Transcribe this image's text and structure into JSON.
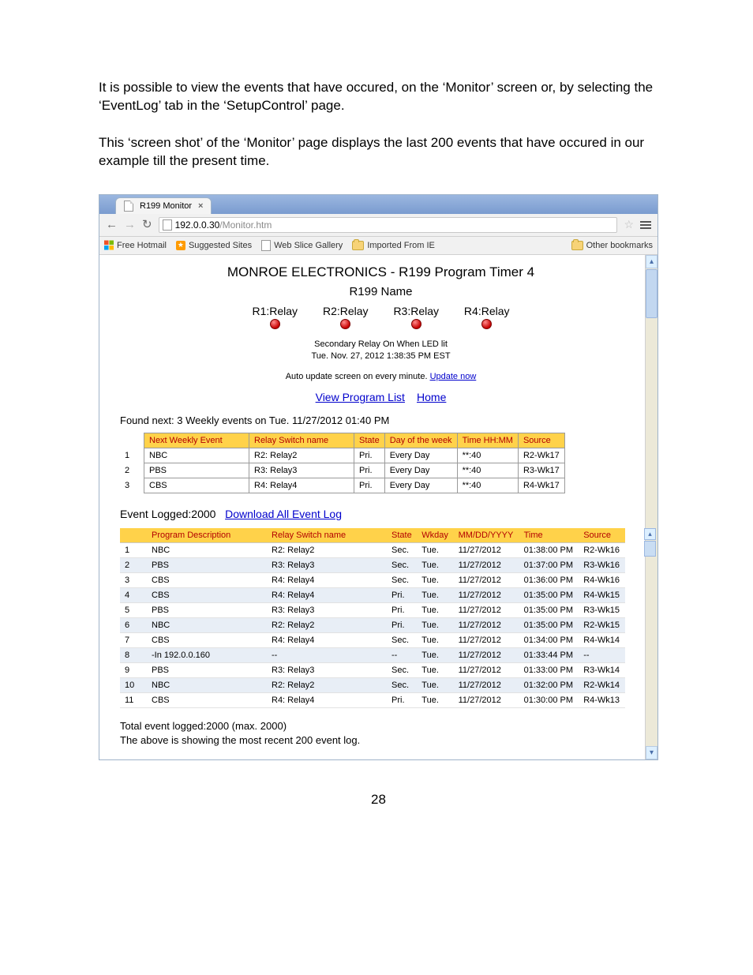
{
  "doc": {
    "para1": "It is possible to view the events that have occured, on the ‘Monitor’ screen or, by selecting the ‘EventLog’ tab in the ‘SetupControl’ page.",
    "para2": "This ‘screen shot’ of the ‘Monitor’ page displays the last 200 events that have occured in our example till the present time.",
    "page_number": "28"
  },
  "browser": {
    "tab_title": "R199 Monitor",
    "url_host": "192.0.0.30",
    "url_path": "/Monitor.htm",
    "bookmarks": {
      "free_hotmail": "Free Hotmail",
      "suggested_sites": "Suggested Sites",
      "web_slice_gallery": "Web Slice Gallery",
      "imported_from_ie": "Imported From IE",
      "other_bookmarks": "Other bookmarks"
    }
  },
  "monitor": {
    "title": "MONROE ELECTRONICS - R199 Program Timer 4",
    "name": "R199 Name",
    "relays": [
      "R1:Relay",
      "R2:Relay",
      "R3:Relay",
      "R4:Relay"
    ],
    "secondary_line1": "Secondary Relay On When LED lit",
    "secondary_line2": "Tue. Nov. 27, 2012 1:38:35 PM EST",
    "auto_update_text": "Auto update screen on every minute. ",
    "update_now": "Update now",
    "view_program_list": "View Program List",
    "home": "Home",
    "found_next": "Found next: 3 Weekly events on Tue. 11/27/2012 01:40 PM",
    "weekly_headers": [
      "Next Weekly Event",
      "Relay Switch name",
      "State",
      "Day of the week",
      "Time HH:MM",
      "Source"
    ],
    "weekly_rows": [
      {
        "n": "1",
        "event": "NBC",
        "relay": "R2: Relay2",
        "state": "Pri.",
        "day": "Every Day",
        "time": "**:40",
        "source": "R2-Wk17"
      },
      {
        "n": "2",
        "event": "PBS",
        "relay": "R3: Relay3",
        "state": "Pri.",
        "day": "Every Day",
        "time": "**:40",
        "source": "R3-Wk17"
      },
      {
        "n": "3",
        "event": "CBS",
        "relay": "R4: Relay4",
        "state": "Pri.",
        "day": "Every Day",
        "time": "**:40",
        "source": "R4-Wk17"
      }
    ],
    "event_logged_label": "Event Logged:2000",
    "download_link": "Download All Event Log",
    "log_headers": [
      "",
      "Program Description",
      "Relay Switch name",
      "State",
      "Wkday",
      "MM/DD/YYYY",
      "Time",
      "Source"
    ],
    "log_rows": [
      {
        "n": "1",
        "desc": "NBC",
        "relay": "R2: Relay2",
        "state": "Sec.",
        "wk": "Tue.",
        "date": "11/27/2012",
        "time": "01:38:00 PM",
        "src": "R2-Wk16"
      },
      {
        "n": "2",
        "desc": "PBS",
        "relay": "R3: Relay3",
        "state": "Sec.",
        "wk": "Tue.",
        "date": "11/27/2012",
        "time": "01:37:00 PM",
        "src": "R3-Wk16"
      },
      {
        "n": "3",
        "desc": "CBS",
        "relay": "R4: Relay4",
        "state": "Sec.",
        "wk": "Tue.",
        "date": "11/27/2012",
        "time": "01:36:00 PM",
        "src": "R4-Wk16"
      },
      {
        "n": "4",
        "desc": "CBS",
        "relay": "R4: Relay4",
        "state": "Pri.",
        "wk": "Tue.",
        "date": "11/27/2012",
        "time": "01:35:00 PM",
        "src": "R4-Wk15"
      },
      {
        "n": "5",
        "desc": "PBS",
        "relay": "R3: Relay3",
        "state": "Pri.",
        "wk": "Tue.",
        "date": "11/27/2012",
        "time": "01:35:00 PM",
        "src": "R3-Wk15"
      },
      {
        "n": "6",
        "desc": "NBC",
        "relay": "R2: Relay2",
        "state": "Pri.",
        "wk": "Tue.",
        "date": "11/27/2012",
        "time": "01:35:00 PM",
        "src": "R2-Wk15"
      },
      {
        "n": "7",
        "desc": "CBS",
        "relay": "R4: Relay4",
        "state": "Sec.",
        "wk": "Tue.",
        "date": "11/27/2012",
        "time": "01:34:00 PM",
        "src": "R4-Wk14"
      },
      {
        "n": "8",
        "desc": "-In 192.0.0.160",
        "relay": "--",
        "state": "--",
        "wk": "Tue.",
        "date": "11/27/2012",
        "time": "01:33:44 PM",
        "src": "--"
      },
      {
        "n": "9",
        "desc": "PBS",
        "relay": "R3: Relay3",
        "state": "Sec.",
        "wk": "Tue.",
        "date": "11/27/2012",
        "time": "01:33:00 PM",
        "src": "R3-Wk14"
      },
      {
        "n": "10",
        "desc": "NBC",
        "relay": "R2: Relay2",
        "state": "Sec.",
        "wk": "Tue.",
        "date": "11/27/2012",
        "time": "01:32:00 PM",
        "src": "R2-Wk14"
      },
      {
        "n": "11",
        "desc": "CBS",
        "relay": "R4: Relay4",
        "state": "Pri.",
        "wk": "Tue.",
        "date": "11/27/2012",
        "time": "01:30:00 PM",
        "src": "R4-Wk13"
      }
    ],
    "total_line1": "Total event logged:2000 (max. 2000)",
    "total_line2": "The above is showing the most recent 200 event log."
  }
}
